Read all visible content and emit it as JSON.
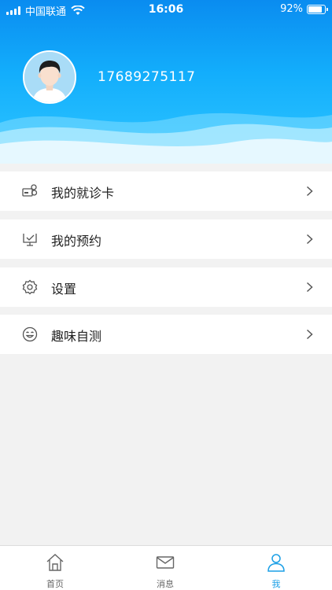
{
  "status_bar": {
    "carrier": "中国联通",
    "time": "16:06",
    "battery_percent": "92%",
    "battery_level": 0.92,
    "signal_icon": "signal-bars-icon",
    "wifi_icon": "wifi-icon",
    "battery_icon": "battery-icon"
  },
  "profile": {
    "phone": "17689275117",
    "avatar_icon": "avatar-icon"
  },
  "menu": {
    "items": [
      {
        "label": "我的就诊卡",
        "icon": "medical-card-icon"
      },
      {
        "label": "我的预约",
        "icon": "appointment-icon"
      },
      {
        "label": "设置",
        "icon": "gear-icon"
      },
      {
        "label": "趣味自测",
        "icon": "smiley-icon"
      }
    ]
  },
  "tabbar": {
    "tabs": [
      {
        "label": "首页",
        "icon": "home-icon",
        "active": false
      },
      {
        "label": "消息",
        "icon": "mail-icon",
        "active": false
      },
      {
        "label": "我",
        "icon": "user-icon",
        "active": true
      }
    ]
  },
  "colors": {
    "header_top": "#0a8cf0",
    "header_bottom": "#2fc6ff",
    "accent": "#1a9fe6",
    "background": "#f2f2f2"
  }
}
